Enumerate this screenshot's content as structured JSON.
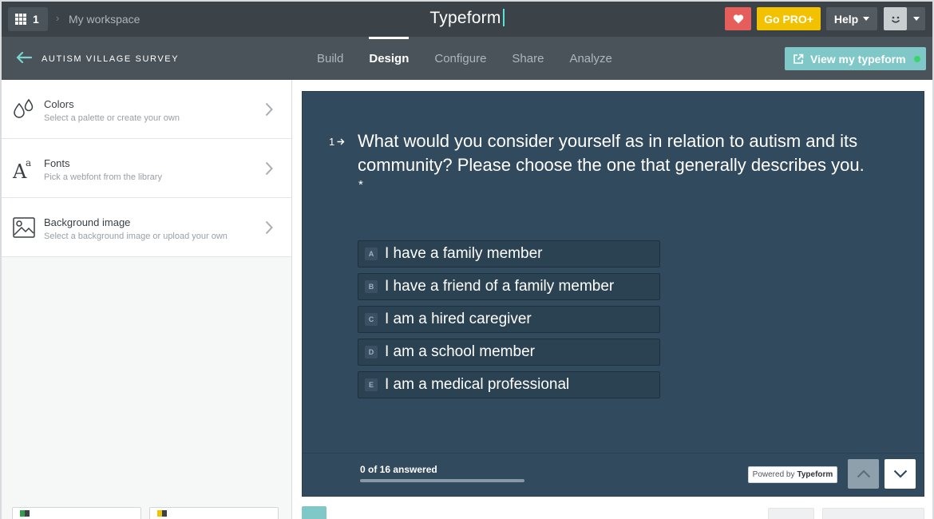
{
  "topbar": {
    "workspace_count": "1",
    "breadcrumb": "My workspace",
    "brand": "Typeform",
    "pro_label": "Go PRO+",
    "help_label": "Help"
  },
  "subbar": {
    "survey_title": "AUTISM VILLAGE SURVEY",
    "tabs": [
      {
        "label": "Build"
      },
      {
        "label": "Design",
        "active": true
      },
      {
        "label": "Configure"
      },
      {
        "label": "Share"
      },
      {
        "label": "Analyze"
      }
    ],
    "view_label": "View my typeform"
  },
  "sidebar": {
    "items": [
      {
        "title": "Colors",
        "subtitle": "Select a palette or create your own",
        "icon": "droplets-icon"
      },
      {
        "title": "Fonts",
        "subtitle": "Pick a webfont from the library",
        "icon": "font-icon"
      },
      {
        "title": "Background image",
        "subtitle": "Select a background image or upload your own",
        "icon": "image-icon"
      }
    ]
  },
  "preview": {
    "question_number": "1",
    "question_text": "What would you consider yourself as in relation to autism and its community? Please choose the one that generally describes you.",
    "required_mark": "*",
    "choices": [
      {
        "key": "A",
        "label": "I have a family member"
      },
      {
        "key": "B",
        "label": "I have a friend of a family member"
      },
      {
        "key": "C",
        "label": "I am a hired caregiver"
      },
      {
        "key": "D",
        "label": "I am a school member"
      },
      {
        "key": "E",
        "label": "I am a medical professional"
      }
    ],
    "progress_text": "0 of 16 answered",
    "progress_fraction": 0,
    "powered_prefix": "Powered by",
    "powered_brand": "Typeform"
  },
  "colors": {
    "topbar": "#3b4349",
    "subbar": "#4a535a",
    "preview_bg": "#324a5e",
    "pro_yellow": "#f2c200",
    "heart_red": "#e55e5b",
    "view_teal": "#80c7c8"
  }
}
